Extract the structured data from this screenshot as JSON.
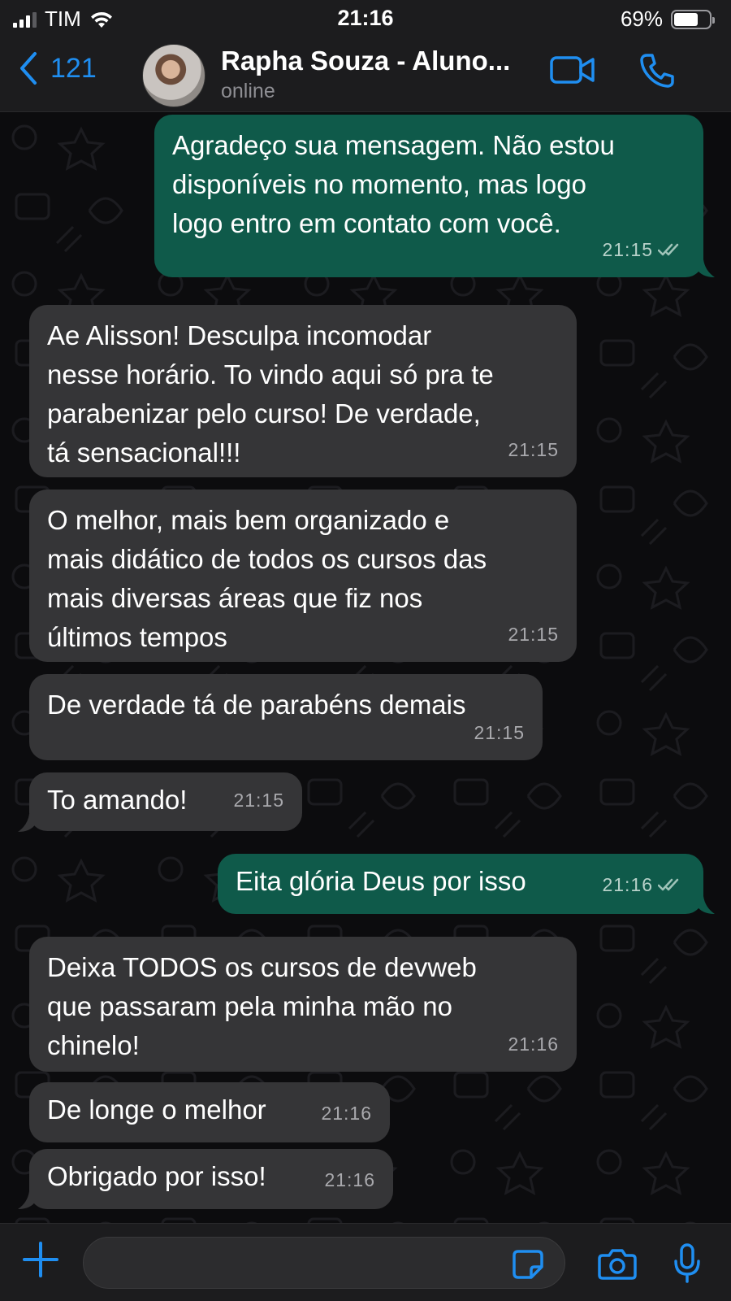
{
  "status_bar": {
    "carrier": "TIM",
    "time": "21:16",
    "battery_percent": "69%",
    "battery_level": 0.69,
    "signal_icon": "signal-bars-icon",
    "wifi_icon": "wifi-icon"
  },
  "header": {
    "back_count": "121",
    "contact_name": "Rapha Souza - Aluno...",
    "contact_status": "online",
    "icons": [
      "chevron-left-icon",
      "video-call-icon",
      "phone-call-icon"
    ]
  },
  "messages": [
    {
      "direction": "out",
      "lines": [
        "Agradeço sua mensagem. Não estou",
        "disponíveis no momento, mas logo",
        "logo entro em contato com você."
      ],
      "time": "21:15",
      "read": true
    },
    {
      "direction": "in",
      "lines": [
        "Ae Alisson! Desculpa incomodar",
        "nesse horário. To vindo aqui só pra te",
        "parabenizar pelo curso! De verdade,",
        "tá sensacional!!!"
      ],
      "time": "21:15"
    },
    {
      "direction": "in",
      "lines": [
        "O melhor, mais bem organizado e",
        "mais didático de todos os cursos das",
        "mais diversas áreas que fiz nos",
        "últimos tempos"
      ],
      "time": "21:15"
    },
    {
      "direction": "in",
      "lines": [
        "De verdade tá de parabéns demais"
      ],
      "time": "21:15"
    },
    {
      "direction": "in",
      "lines": [
        "To amando!"
      ],
      "time": "21:15"
    },
    {
      "direction": "out",
      "lines": [
        "Eita glória Deus por isso"
      ],
      "time": "21:16",
      "read": true
    },
    {
      "direction": "in",
      "lines": [
        "Deixa TODOS os cursos de devweb",
        "que passaram pela minha mão no",
        "chinelo!"
      ],
      "time": "21:16"
    },
    {
      "direction": "in",
      "lines": [
        "De longe o melhor"
      ],
      "time": "21:16"
    },
    {
      "direction": "in",
      "lines": [
        "Obrigado por isso!"
      ],
      "time": "21:16"
    }
  ],
  "input_bar": {
    "message_value": "",
    "icons": [
      "plus-icon",
      "sticker-icon",
      "camera-icon",
      "microphone-icon"
    ]
  },
  "colors": {
    "accent": "#1f8ef1",
    "bubble_in": "#353537",
    "bubble_out": "#0f5a4a",
    "read_ticks": "#b7d1c9"
  }
}
